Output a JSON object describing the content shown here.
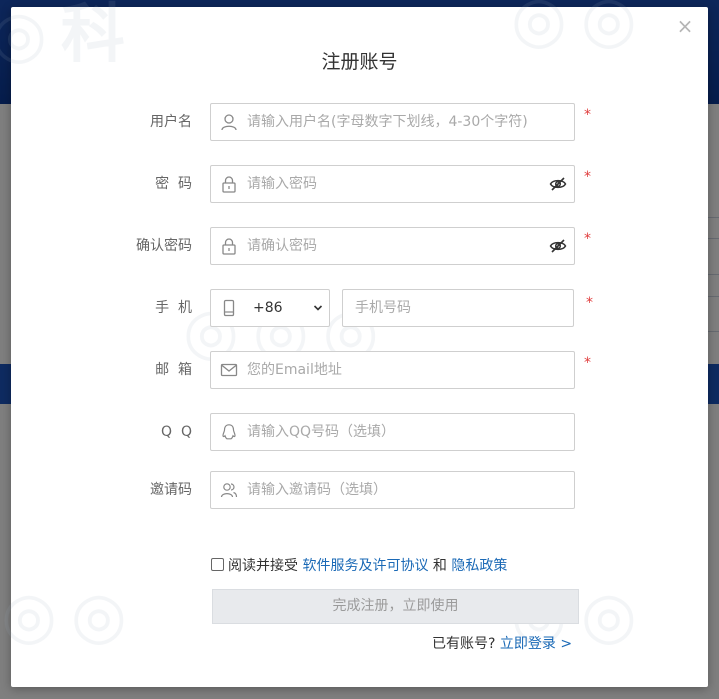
{
  "modal": {
    "title": "注册账号",
    "close_label": "×"
  },
  "fields": {
    "username": {
      "label": "用户名",
      "placeholder": "请输入用户名(字母数字下划线，4-30个字符)",
      "required": "*"
    },
    "password": {
      "label": "密  码",
      "placeholder": "请输入密码",
      "required": "*"
    },
    "confirm_password": {
      "label": "确认密码",
      "placeholder": "请确认密码",
      "required": "*"
    },
    "phone": {
      "label": "手  机",
      "country_code": "+86",
      "placeholder": "手机号码",
      "required": "*"
    },
    "email": {
      "label": "邮  箱",
      "placeholder": "您的Email地址",
      "required": "*"
    },
    "qq": {
      "label": "Q  Q",
      "placeholder": "请输入QQ号码（选填）"
    },
    "invite": {
      "label": "邀请码",
      "placeholder": "请输入邀请码（选填）"
    }
  },
  "agreement": {
    "prefix": "阅读并接受",
    "terms_link": "软件服务及许可协议",
    "and": "和",
    "privacy_link": "隐私政策"
  },
  "submit_label": "完成注册，立即使用",
  "login": {
    "prompt": "已有账号?",
    "link": "立即登录 >"
  },
  "colors": {
    "link": "#1a69b6",
    "required": "#e03c3c",
    "page_blue": "#0b3a98"
  }
}
